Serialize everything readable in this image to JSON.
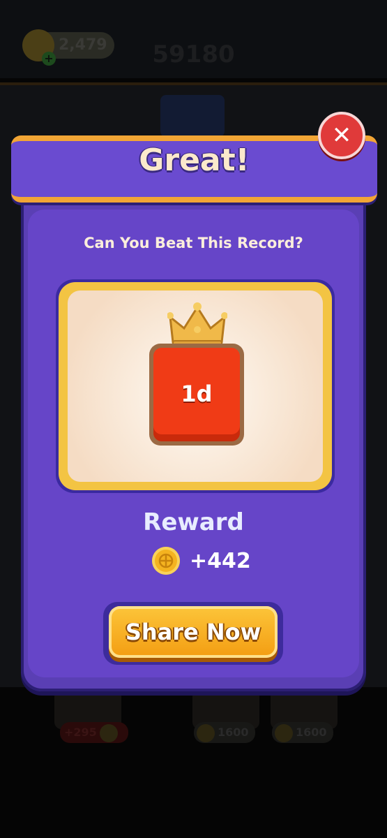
{
  "hud": {
    "coins": "2,479",
    "coin_add": "+",
    "score": "59180"
  },
  "board_items": [
    {
      "price": "+295"
    },
    {
      "price": "1600"
    },
    {
      "price": "1600"
    }
  ],
  "modal": {
    "title": "Great!",
    "close_label": "✕",
    "subtitle": "Can You Beat This Record?",
    "record_tile": "1d",
    "reward_title": "Reward",
    "reward_amount": "+442",
    "share_label": "Share Now"
  },
  "colors": {
    "modal_purple": "#6645c8",
    "banner_gold": "#f2a535",
    "tile_red": "#f03b16",
    "button_orange": "#f39d12",
    "close_red": "#e03a3a"
  }
}
